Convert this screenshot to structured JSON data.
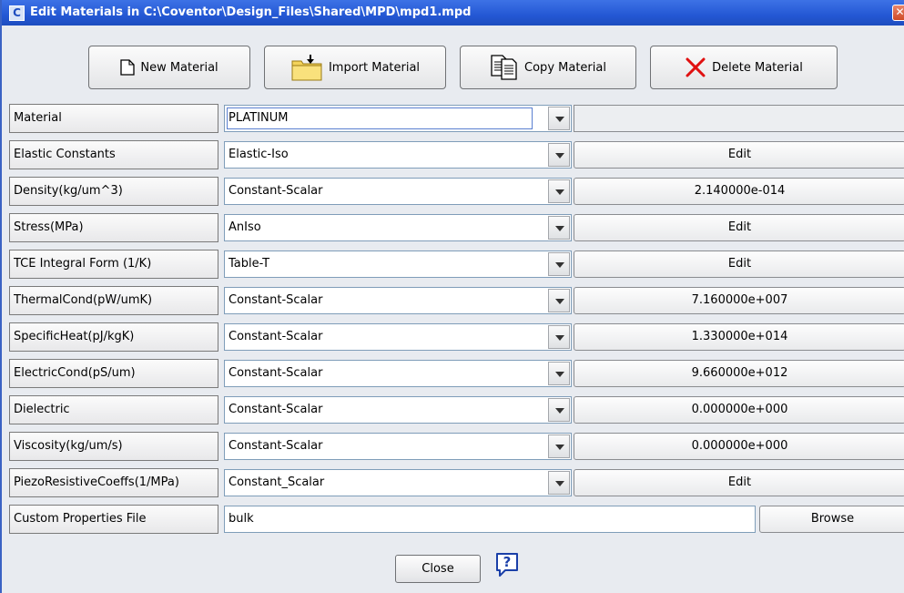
{
  "window": {
    "title": "Edit Materials in C:\\Coventor\\Design_Files\\Shared\\MPD\\mpd1.mpd",
    "app_icon_letter": "C",
    "close_glyph": "✕"
  },
  "toolbar": {
    "new_material": "New Material",
    "import_material": "Import Material",
    "copy_material": "Copy Material",
    "delete_material": "Delete Material"
  },
  "properties": {
    "material": {
      "label": "Material",
      "type": "PLATINUM",
      "value": ""
    },
    "elastic": {
      "label": "Elastic Constants",
      "type": "Elastic-Iso",
      "value": "Edit"
    },
    "density": {
      "label": "Density(kg/um^3)",
      "type": "Constant-Scalar",
      "value": "2.140000e-014"
    },
    "stress": {
      "label": "Stress(MPa)",
      "type": "AnIso",
      "value": "Edit"
    },
    "tce": {
      "label": "TCE Integral Form (1/K)",
      "type": "Table-T",
      "value": "Edit"
    },
    "thermalcond": {
      "label": "ThermalCond(pW/umK)",
      "type": "Constant-Scalar",
      "value": "7.160000e+007"
    },
    "specificheat": {
      "label": "SpecificHeat(pJ/kgK)",
      "type": "Constant-Scalar",
      "value": "1.330000e+014"
    },
    "electriccond": {
      "label": "ElectricCond(pS/um)",
      "type": "Constant-Scalar",
      "value": "9.660000e+012"
    },
    "dielectric": {
      "label": "Dielectric",
      "type": "Constant-Scalar",
      "value": "0.000000e+000"
    },
    "viscosity": {
      "label": "Viscosity(kg/um/s)",
      "type": "Constant-Scalar",
      "value": "0.000000e+000"
    },
    "piezo": {
      "label": "PiezoResistiveCoeffs(1/MPa)",
      "type": "Constant_Scalar",
      "value": "Edit"
    }
  },
  "custom_file": {
    "label": "Custom Properties File",
    "value": "bulk",
    "browse": "Browse"
  },
  "footer": {
    "close": "Close",
    "help": "?"
  },
  "icons": {
    "new": "page-icon",
    "import": "folder-import-icon",
    "copy": "copy-pages-icon",
    "delete": "red-x-icon"
  }
}
